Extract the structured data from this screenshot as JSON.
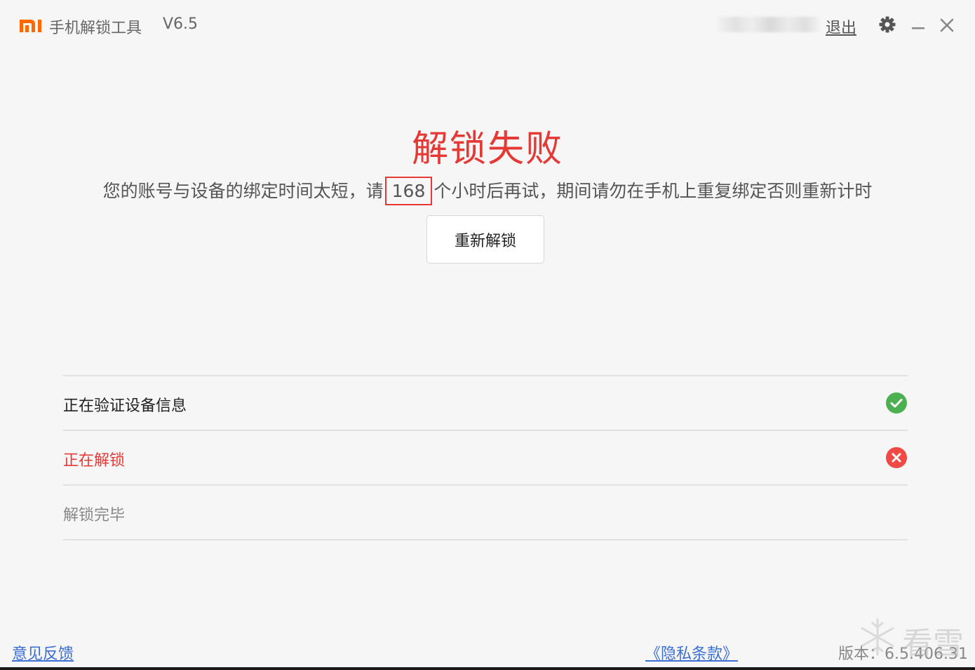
{
  "titlebar": {
    "app_title": "手机解锁工具",
    "version_label": "V6.5",
    "logout_label": "退出"
  },
  "result": {
    "title": "解锁失败",
    "message_before": "您的账号与设备的绑定时间太短，请",
    "hours": "168",
    "message_after": "个小时后再试，期间请勿在手机上重复绑定否则重新计时",
    "retry_label": "重新解锁"
  },
  "steps": [
    {
      "label": "正在验证设备信息",
      "status": "done"
    },
    {
      "label": "正在解锁",
      "status": "failed"
    },
    {
      "label": "解锁完毕",
      "status": "pending"
    }
  ],
  "footer": {
    "feedback_label": "意见反馈",
    "privacy_label": "《隐私条款》",
    "version_text": "版本：6.5.406.31"
  },
  "watermark": {
    "text": "看雪"
  },
  "colors": {
    "accent_red": "#e53935",
    "logo_orange": "#ff6700",
    "success_green": "#4caf50",
    "link_blue": "#3b6fd3"
  },
  "icons": {
    "logo": "mi-logo-icon",
    "settings": "gear-icon",
    "minimize": "minimize-icon",
    "close": "close-icon",
    "done": "check-circle-icon",
    "failed": "x-circle-icon"
  }
}
